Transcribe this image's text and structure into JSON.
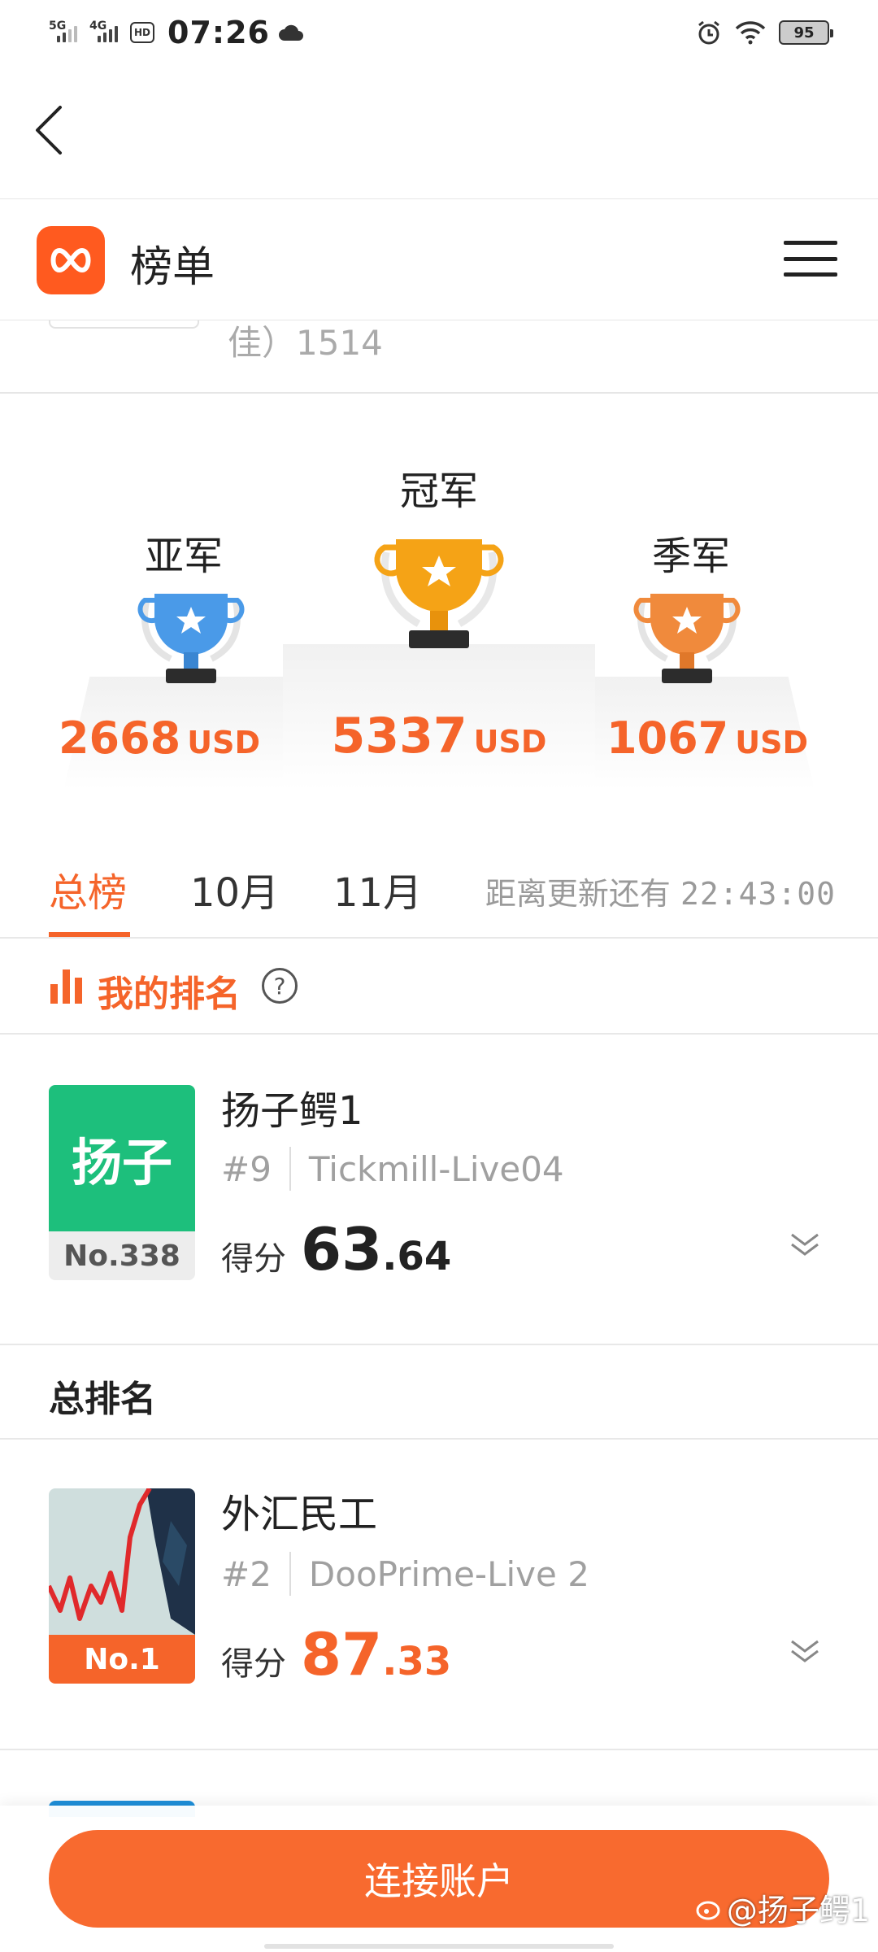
{
  "status_bar": {
    "signal1": "5G",
    "signal2": "4G",
    "hd": "HD",
    "time": "07:26",
    "battery": "95"
  },
  "app": {
    "title": "榜单",
    "partial_text": "佳）1514"
  },
  "podium": {
    "second": {
      "label": "亚军",
      "amount": "2668",
      "unit": "USD"
    },
    "first": {
      "label": "冠军",
      "amount": "5337",
      "unit": "USD"
    },
    "third": {
      "label": "季军",
      "amount": "1067",
      "unit": "USD"
    },
    "colors": {
      "gold": "#f5a316",
      "silver": "#4a9ae8",
      "bronze": "#f08a3c"
    }
  },
  "tabs": [
    {
      "label": "总榜",
      "active": true
    },
    {
      "label": "10月",
      "active": false
    },
    {
      "label": "11月",
      "active": false
    }
  ],
  "countdown": {
    "label": "距离更新还有",
    "time": "22:43:00"
  },
  "my_rank": {
    "title": "我的排名",
    "help": "?",
    "card": {
      "avatar_text": "扬子",
      "rank_no": "No.338",
      "name": "扬子鳄1",
      "position": "#9",
      "server": "Tickmill-Live04",
      "score_label": "得分",
      "score_int": "63",
      "score_dec": ".64"
    }
  },
  "overall": {
    "title": "总排名",
    "items": [
      {
        "rank_no": "No.1",
        "name": "外汇民工",
        "position": "#2",
        "server": "DooPrime-Live 2",
        "score_label": "得分",
        "score_int": "87",
        "score_dec": ".33"
      }
    ]
  },
  "bottom": {
    "connect_label": "连接账户",
    "watermark": "@扬子鳄1"
  },
  "colors": {
    "accent": "#f5642a",
    "green_avatar": "#1dbf7c"
  }
}
